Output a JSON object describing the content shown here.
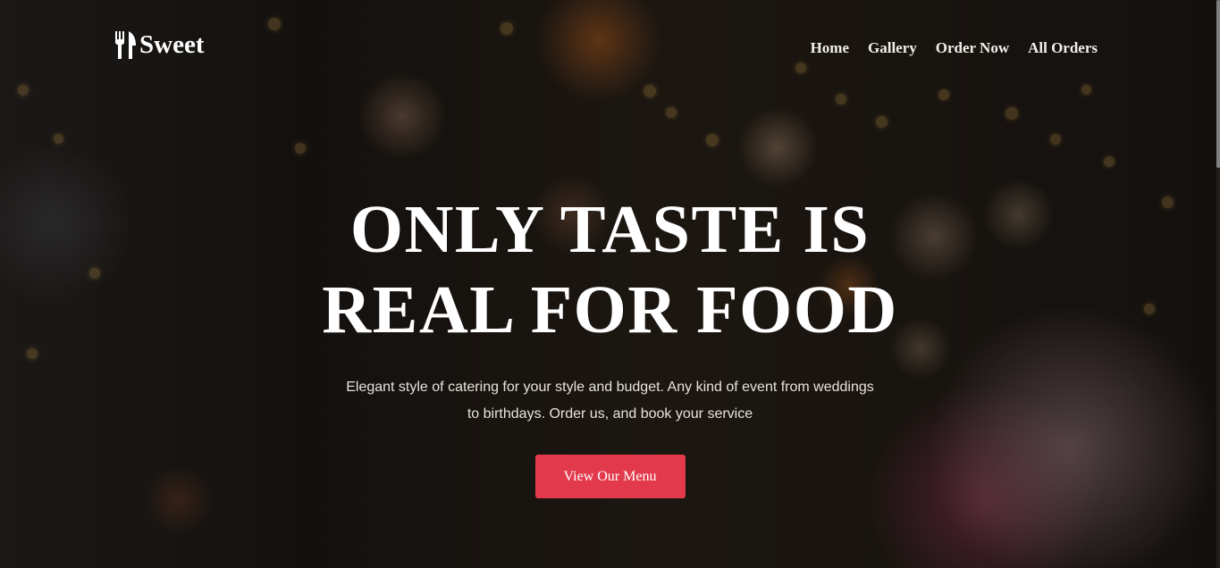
{
  "brand": {
    "name": "Sweet",
    "icon": "fork-knife-icon"
  },
  "nav": {
    "items": [
      {
        "label": "Home"
      },
      {
        "label": "Gallery"
      },
      {
        "label": "Order Now"
      },
      {
        "label": "All Orders"
      }
    ]
  },
  "hero": {
    "headline_line1": "ONLY TASTE IS",
    "headline_line2": "REAL FOR FOOD",
    "subtitle": "Elegant style of catering for your style and budget. Any kind of event from weddings to birthdays. Order us, and book your service",
    "cta_label": "View Our Menu"
  },
  "colors": {
    "accent": "#e23a4c",
    "text": "#ffffff"
  }
}
